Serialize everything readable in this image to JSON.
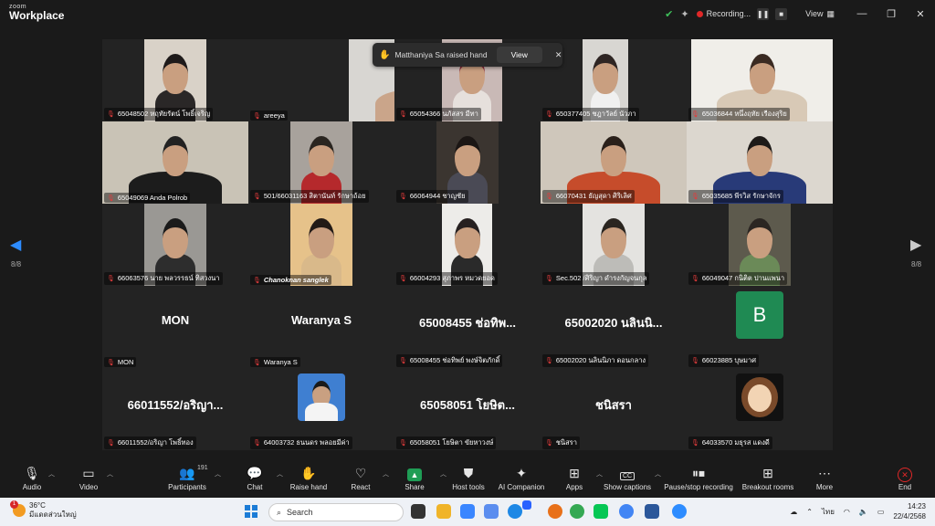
{
  "app": {
    "brand_small": "zoom",
    "brand_main": "Workplace"
  },
  "titlebar": {
    "recording_label": "Recording...",
    "pause_icon": "pause-icon",
    "stop_icon": "stop-icon",
    "view_label": "View",
    "window_controls": [
      "—",
      "❐",
      "✕"
    ]
  },
  "notification": {
    "message": "Matthaniya Sa raised hand",
    "view_label": "View",
    "close": "✕"
  },
  "nav": {
    "left_page": "8/8",
    "right_page": "8/8"
  },
  "tiles": [
    {
      "name": "65048502 หฤทัยรัตน์ โพธิ์เจริญ",
      "kind": "video"
    },
    {
      "name": "areeya",
      "kind": "video"
    },
    {
      "name": "65054366 นภัสสร มีทา",
      "kind": "video"
    },
    {
      "name": "650377405 ชฎาวัลย์ นัวภา",
      "kind": "video"
    },
    {
      "name": "65036844 หนึ่งฤทัย เรืองสุริย",
      "kind": "video"
    },
    {
      "name": "65049069 Anda Polrob",
      "kind": "video"
    },
    {
      "name": "501/66031163 สิตานันท์ รักษาถ้อย",
      "kind": "video"
    },
    {
      "name": "66064944 ชาญชัย",
      "kind": "video"
    },
    {
      "name": "66070431 ธัญสุดา ศิริเลิศ",
      "kind": "video"
    },
    {
      "name": "65035685 พีรวิส รักษาจักร",
      "kind": "video"
    },
    {
      "name": "66063576 นาย พลวรรธน์ ทิสวงนา",
      "kind": "video"
    },
    {
      "name": "Chanoknan sanglek",
      "kind": "video"
    },
    {
      "name": "66004293 สุภาพร หมวดยอด",
      "kind": "video"
    },
    {
      "name": "Sec.502 /ศิริญา ดำรงกัญจนกุล",
      "kind": "video"
    },
    {
      "name": "66049047 กนิติต ปานแพนา",
      "kind": "video"
    },
    {
      "name": "MON",
      "big": "MON",
      "kind": "name"
    },
    {
      "name": "Waranya S",
      "big": "Waranya S",
      "kind": "name"
    },
    {
      "name": "65008455 ช่อทิพย์ พงษ์จิตภักดิ์",
      "big": "65008455 ช่อทิพ...",
      "kind": "name"
    },
    {
      "name": "65002020 นลินนิภา ดอนกลาง",
      "big": "65002020 นลินนิ...",
      "kind": "name"
    },
    {
      "name": "66023885 บุษมาศ",
      "avatar_letter": "B",
      "kind": "avatar"
    },
    {
      "name": "66011552/อริญา โพธิ์ทอง",
      "big": "66011552/อริญา...",
      "kind": "name"
    },
    {
      "name": "64003732 ธนนดร พลอยมีค่า",
      "kind": "photo"
    },
    {
      "name": "65058051 โยษิตา ขัยหาวงษ์",
      "big": "65058051 โยษิต...",
      "kind": "name"
    },
    {
      "name": "ชนิสรา",
      "big": "ชนิสรา",
      "kind": "name"
    },
    {
      "name": "64033570 มธุรส แดงดี",
      "kind": "cartoon"
    }
  ],
  "toolbar": {
    "audio": "Audio",
    "video": "Video",
    "participants": "Participants",
    "participants_count": "191",
    "chat": "Chat",
    "raise_hand": "Raise hand",
    "react": "React",
    "share": "Share",
    "host_tools": "Host tools",
    "ai_companion": "AI Companion",
    "apps": "Apps",
    "show_captions": "Show captions",
    "pause_stop": "Pause/stop recording",
    "breakout": "Breakout rooms",
    "more": "More",
    "end": "End",
    "cc_icon": "CC"
  },
  "taskbar": {
    "temperature": "36°C",
    "weather_desc": "มีแดดส่วนใหญ่",
    "weather_badge": "1",
    "search_placeholder": "Search",
    "language": "ไทย",
    "time": "14:23",
    "date": "22/4/2568"
  }
}
